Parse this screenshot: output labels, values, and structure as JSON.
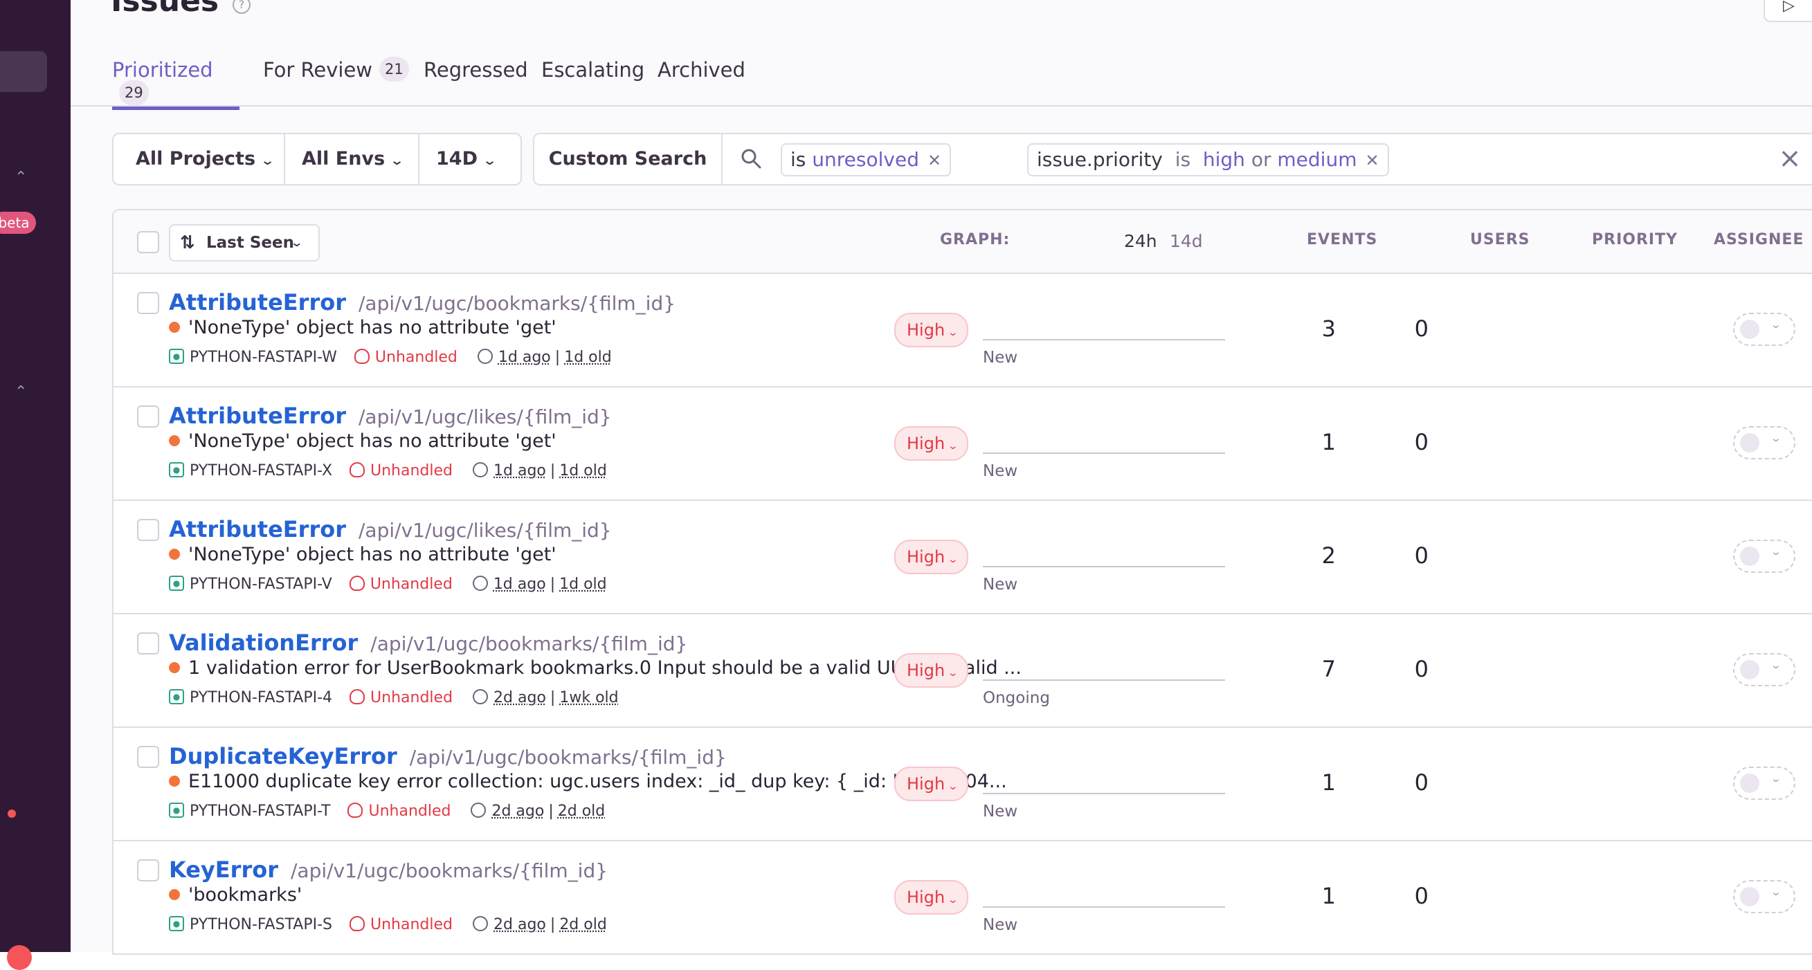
{
  "sidebar": {
    "beta_label": "beta"
  },
  "page": {
    "title": "Issues",
    "help_symbol": "?"
  },
  "tabs": [
    {
      "label": "Prioritized",
      "count": "29"
    },
    {
      "label": "For Review",
      "count": "21"
    },
    {
      "label": "Regressed"
    },
    {
      "label": "Escalating"
    },
    {
      "label": "Archived"
    }
  ],
  "filters": {
    "projects": "All Projects",
    "envs": "All Envs",
    "period": "14D"
  },
  "search": {
    "custom_label": "Custom Search",
    "token1": {
      "key": "is",
      "value": "unresolved"
    },
    "token2": {
      "key": "issue.priority",
      "op1": "is",
      "v1": "high",
      "op2": "or",
      "v2": "medium"
    }
  },
  "table": {
    "sort_label": "Last Seen",
    "headers": {
      "graph": "GRAPH:",
      "h24": "24h",
      "d14": "14d",
      "events": "EVENTS",
      "users": "USERS",
      "priority": "PRIORITY",
      "assignee": "ASSIGNEE"
    },
    "rows": [
      {
        "type": "AttributeError",
        "path": "/api/v1/ugc/bookmarks/{film_id}",
        "message": "'NoneType' object has no attribute 'get'",
        "project": "PYTHON-FASTAPI-W",
        "handled": "Unhandled",
        "last": "1d ago",
        "first": "1d old",
        "graph_label": "New",
        "events": "3",
        "users": "0",
        "priority": "High"
      },
      {
        "type": "AttributeError",
        "path": "/api/v1/ugc/likes/{film_id}",
        "message": "'NoneType' object has no attribute 'get'",
        "project": "PYTHON-FASTAPI-X",
        "handled": "Unhandled",
        "last": "1d ago",
        "first": "1d old",
        "graph_label": "New",
        "events": "1",
        "users": "0",
        "priority": "High"
      },
      {
        "type": "AttributeError",
        "path": "/api/v1/ugc/likes/{film_id}",
        "message": "'NoneType' object has no attribute 'get'",
        "project": "PYTHON-FASTAPI-V",
        "handled": "Unhandled",
        "last": "1d ago",
        "first": "1d old",
        "graph_label": "New",
        "events": "2",
        "users": "0",
        "priority": "High"
      },
      {
        "type": "ValidationError",
        "path": "/api/v1/ugc/bookmarks/{film_id}",
        "message": "1 validation error for UserBookmark bookmarks.0 Input should be a valid UUID, invalid ...",
        "project": "PYTHON-FASTAPI-4",
        "handled": "Unhandled",
        "last": "2d ago",
        "first": "1wk old",
        "graph_label": "Ongoing",
        "events": "7",
        "users": "0",
        "priority": "High"
      },
      {
        "type": "DuplicateKeyError",
        "path": "/api/v1/ugc/bookmarks/{film_id}",
        "message": "E11000 duplicate key error collection: ugc.users index: _id_ dup key: { _id: \"c178ef04...",
        "project": "PYTHON-FASTAPI-T",
        "handled": "Unhandled",
        "last": "2d ago",
        "first": "2d old",
        "graph_label": "New",
        "events": "1",
        "users": "0",
        "priority": "High"
      },
      {
        "type": "KeyError",
        "path": "/api/v1/ugc/bookmarks/{film_id}",
        "message": "'bookmarks'",
        "project": "PYTHON-FASTAPI-S",
        "handled": "Unhandled",
        "last": "2d ago",
        "first": "2d old",
        "graph_label": "New",
        "events": "1",
        "users": "0",
        "priority": "High"
      }
    ]
  }
}
